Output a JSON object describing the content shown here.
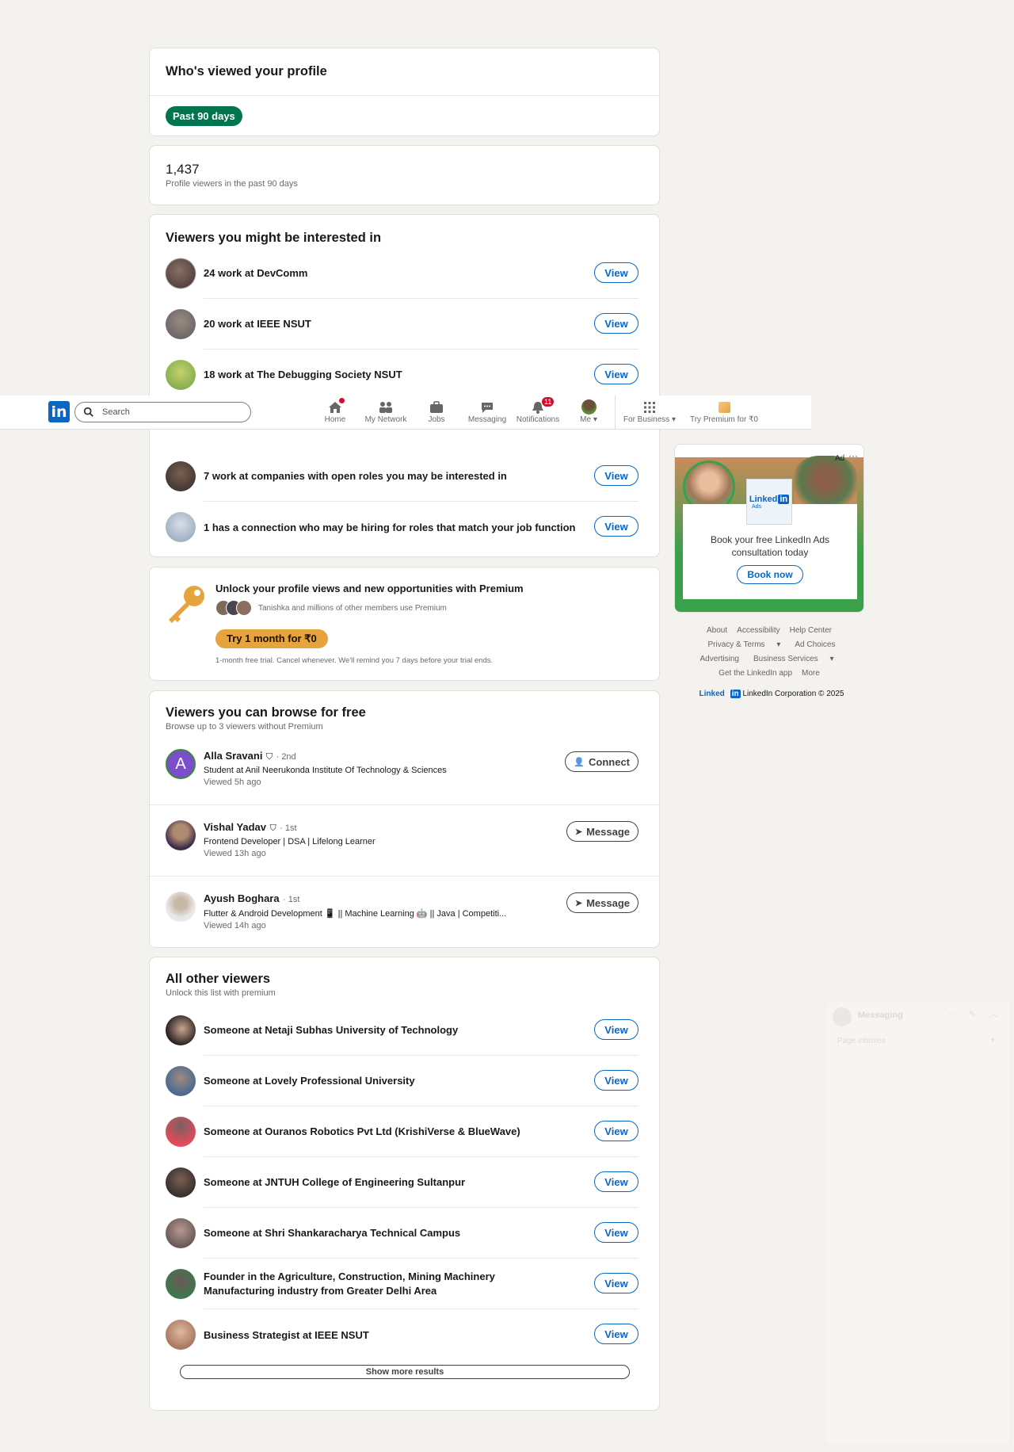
{
  "viewers_card": {
    "title": "Who's viewed your profile",
    "filter": "Past 90 days"
  },
  "stats": {
    "count": "1,437",
    "label": "Profile viewers in the past 90 days"
  },
  "interested": {
    "title": "Viewers you might be interested in",
    "rows": [
      {
        "text": "24 work at  DevComm",
        "button": "View"
      },
      {
        "text": "20 work at  IEEE NSUT",
        "button": "View"
      },
      {
        "text": "18 work at  The Debugging Society NSUT",
        "button": "View"
      },
      {
        "text": "7 work at companies with open roles you may be interested in",
        "button": "View"
      },
      {
        "text": "1 has a connection who may be hiring for roles that match your job function",
        "button": "View"
      }
    ]
  },
  "premium": {
    "title": "Unlock your profile views and new opportunities with Premium",
    "social": "Tanishka and millions of other members use Premium",
    "cta": "Try 1 month for ₹0",
    "note": "1-month free trial. Cancel whenever. We'll remind you 7 days before your trial ends."
  },
  "free": {
    "title": "Viewers you can browse for free",
    "subtitle": "Browse up to 3 viewers without Premium",
    "people": [
      {
        "name": "Alla Sravani",
        "degree": "· 2nd",
        "headline": "Student at Anil Neerukonda Institute Of Technology & Sciences",
        "ago": "Viewed 5h ago",
        "button": "Connect",
        "initial": "A"
      },
      {
        "name": "Vishal Yadav",
        "degree": "· 1st",
        "headline": "Frontend Developer | DSA | Lifelong Learner",
        "ago": "Viewed 13h ago",
        "button": "Message"
      },
      {
        "name": "Ayush Boghara",
        "degree": "· 1st",
        "headline": "Flutter & Android Development 📱 || Machine Learning 🤖 || Java | Competiti...",
        "ago": "Viewed 14h ago",
        "button": "Message"
      }
    ]
  },
  "others": {
    "title": "All other viewers",
    "subtitle": "Unlock this list with premium",
    "rows": [
      {
        "text": "Someone at Netaji Subhas University of Technology",
        "button": "View"
      },
      {
        "text": "Someone at Lovely Professional University",
        "button": "View"
      },
      {
        "text": "Someone at Ouranos Robotics Pvt Ltd (KrishiVerse & BlueWave)",
        "button": "View"
      },
      {
        "text": "Someone at JNTUH College of Engineering Sultanpur",
        "button": "View"
      },
      {
        "text": "Someone at Shri Shankaracharya Technical Campus",
        "button": "View"
      },
      {
        "text": "Founder in the Agriculture, Construction, Mining Machinery Manufacturing industry from Greater Delhi Area",
        "button": "View"
      },
      {
        "text": "Business Strategist at IEEE NSUT",
        "button": "View"
      }
    ],
    "show_more": "Show more results"
  },
  "nav": {
    "search_placeholder": "Search",
    "items": [
      "Home",
      "My Network",
      "Jobs",
      "Messaging",
      "Notifications",
      "Me",
      "For Business",
      "Try Premium for ₹0"
    ],
    "notif_count": "11"
  },
  "ad": {
    "tag": "Ad",
    "text": "Book your free LinkedIn Ads consultation today",
    "cta": "Book now",
    "logo": "Linked",
    "logo_sub": "Ads"
  },
  "footer": {
    "links": [
      "About",
      "Accessibility",
      "Help Center",
      "Privacy & Terms",
      "Ad Choices",
      "Advertising",
      "Business Services",
      "Get the LinkedIn app",
      "More"
    ],
    "copyright": "LinkedIn Corporation © 2025",
    "brand": "Linked"
  },
  "messaging": {
    "title": "Messaging",
    "inbox": "Page inboxes"
  },
  "colors": {
    "brand": "#0a66c2",
    "green": "#01754f",
    "premium": "#e7a33e"
  }
}
